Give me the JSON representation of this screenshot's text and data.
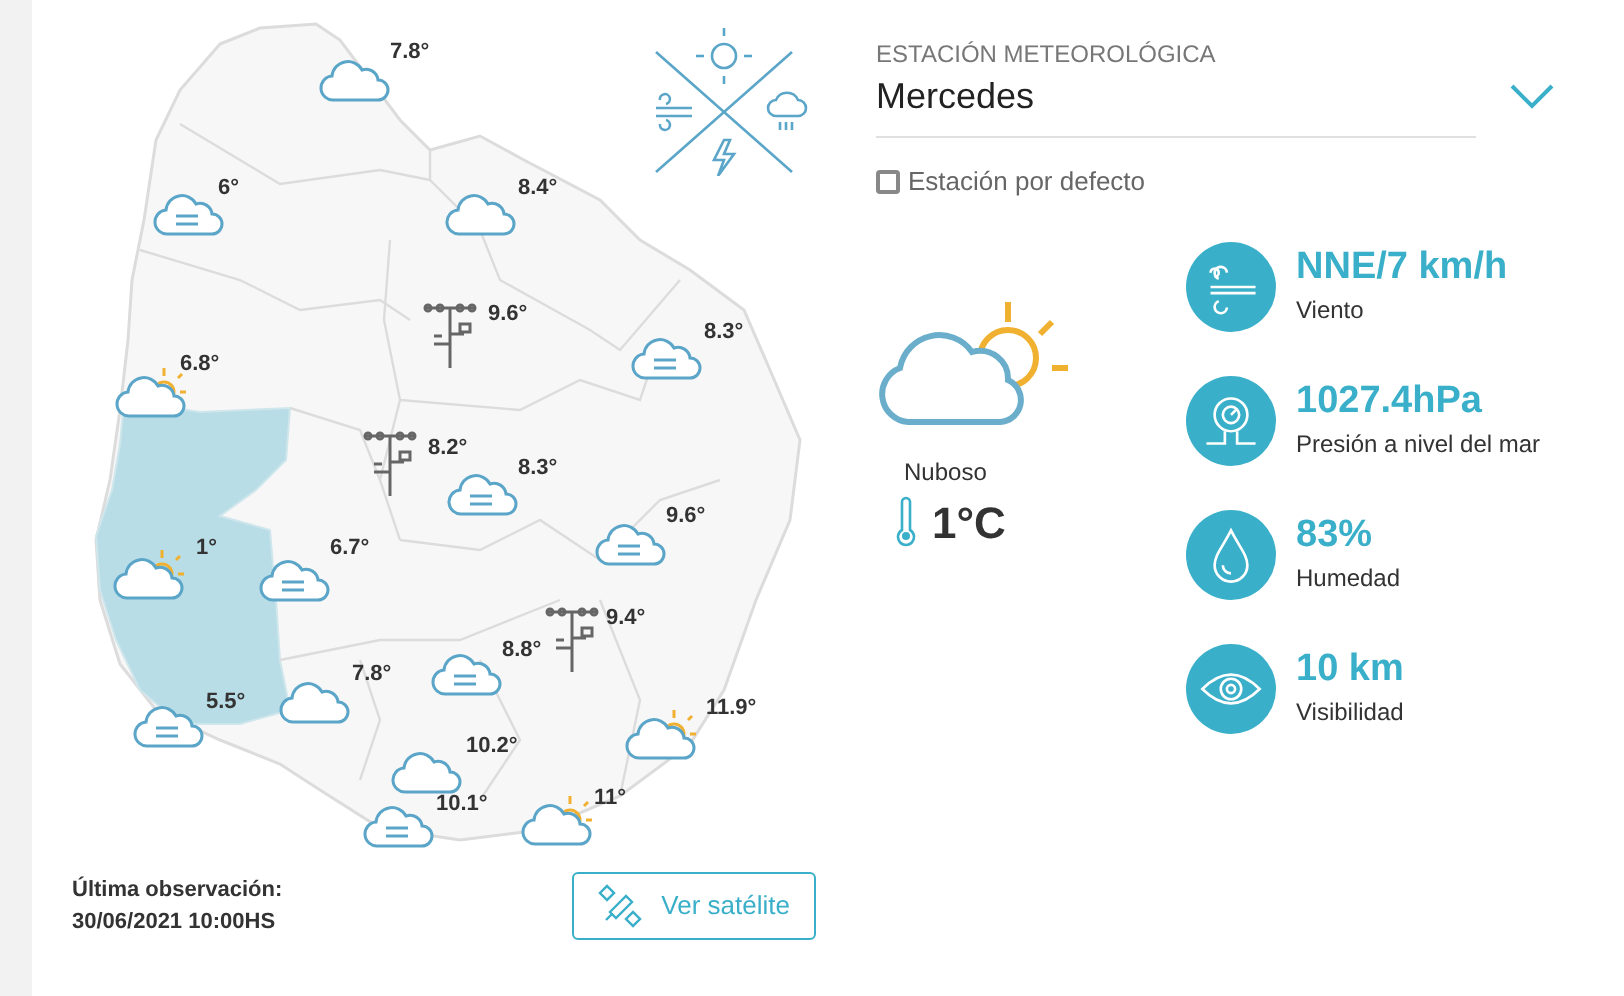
{
  "map": {
    "markers": [
      {
        "kind": "cloud",
        "temp": "7.8°"
      },
      {
        "kind": "fog",
        "temp": "6°"
      },
      {
        "kind": "cloud",
        "temp": "8.4°"
      },
      {
        "kind": "station",
        "temp": "9.6°"
      },
      {
        "kind": "fog",
        "temp": "8.3°"
      },
      {
        "kind": "partly-sunny",
        "temp": "6.8°"
      },
      {
        "kind": "station",
        "temp": "8.2°"
      },
      {
        "kind": "fog",
        "temp": "8.3°"
      },
      {
        "kind": "fog",
        "temp": "9.6°"
      },
      {
        "kind": "partly-sunny",
        "temp": "1°"
      },
      {
        "kind": "fog",
        "temp": "6.7°"
      },
      {
        "kind": "station",
        "temp": "9.4°"
      },
      {
        "kind": "fog",
        "temp": "8.8°"
      },
      {
        "kind": "cloud",
        "temp": "7.8°"
      },
      {
        "kind": "fog",
        "temp": "5.5°"
      },
      {
        "kind": "partly-sunny",
        "temp": "11.9°"
      },
      {
        "kind": "cloud",
        "temp": "10.2°"
      },
      {
        "kind": "fog",
        "temp": "10.1°"
      },
      {
        "kind": "partly-sunny",
        "temp": "11°"
      }
    ]
  },
  "station": {
    "label": "ESTACIÓN METEOROLÓGICA",
    "name": "Mercedes",
    "default_checkbox": {
      "label": "Estación por defecto",
      "checked": false
    }
  },
  "current": {
    "condition": "Nuboso",
    "temperature": "1°C"
  },
  "stats": [
    {
      "kind": "wind",
      "value": "NNE/7 km/h",
      "label": "Viento"
    },
    {
      "kind": "pressure",
      "value": "1027.4hPa",
      "label": "Presión a nivel del mar"
    },
    {
      "kind": "humidity",
      "value": "83%",
      "label": "Humedad"
    },
    {
      "kind": "visibility",
      "value": "10 km",
      "label": "Visibilidad"
    }
  ],
  "footer": {
    "observation_label": "Última observación:",
    "observation_time": "30/06/2021 10:00HS",
    "satellite_button": "Ver satélite"
  }
}
